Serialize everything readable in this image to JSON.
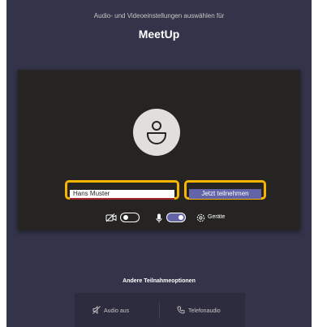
{
  "header": {
    "subtitle": "Audio- und Videoeinstellungen auswählen für",
    "title": "MeetUp"
  },
  "preview": {
    "name_value": "Hans Muster",
    "join_label": "Jetzt teilnehmen",
    "camera_on": false,
    "mic_on": true,
    "devices_label": "Geräte"
  },
  "other_options": {
    "heading": "Andere Teilnahmeoptionen",
    "audio_off_label": "Audio aus",
    "phone_audio_label": "Telefonaudio"
  },
  "colors": {
    "background": "#33344a",
    "preview_bg": "#252423",
    "accent": "#6264a7",
    "highlight": "#f7b500"
  },
  "icons": [
    "person-icon",
    "camera-off-icon",
    "microphone-icon",
    "gear-icon",
    "speaker-off-icon",
    "phone-icon"
  ]
}
